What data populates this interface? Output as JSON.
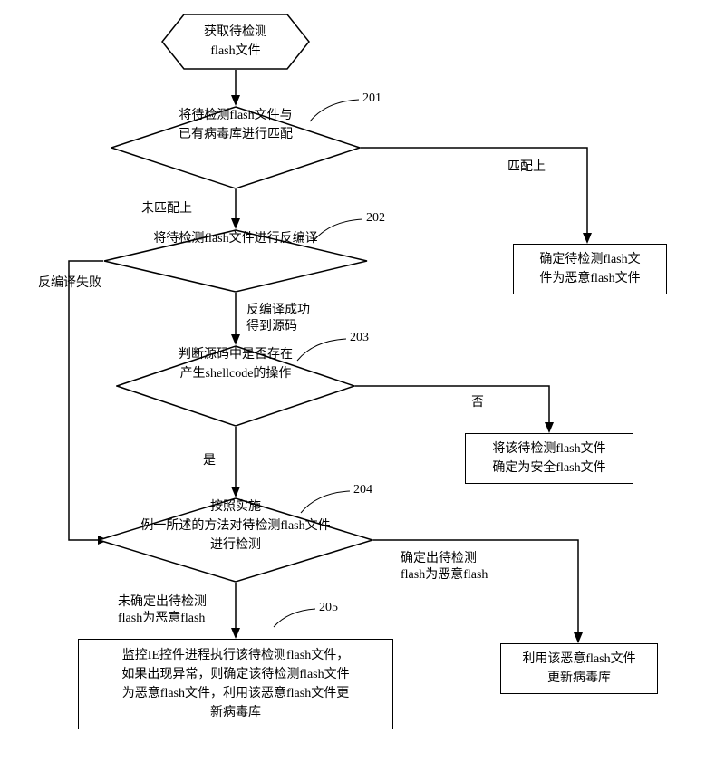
{
  "title": "恶意flash文件检测流程图",
  "start": {
    "text": "获取待检测\nflash文件"
  },
  "steps": {
    "s201": {
      "num": "201",
      "text": "将待检测flash文件与\n已有病毒库进行匹配"
    },
    "s202": {
      "num": "202",
      "text": "将待检测flash文件进行反编译"
    },
    "s203": {
      "num": "203",
      "text": "判断源码中是否存在\n产生shellcode的操作"
    },
    "s204": {
      "num": "204",
      "text": "按照实施\n例一所述的方法对待检测flash文件\n进行检测"
    },
    "s205": {
      "num": "205",
      "text": "监控IE控件进程执行该待检测flash文件，\n如果出现异常，则确定该待检测flash文件\n为恶意flash文件，利用该恶意flash文件更\n新病毒库"
    }
  },
  "boxes": {
    "malicious": "确定待检测flash文\n件为恶意flash文件",
    "safe": "将该待检测flash文件\n确定为安全flash文件",
    "update": "利用该恶意flash文件\n更新病毒库"
  },
  "edges": {
    "matched": "匹配上",
    "unmatched": "未匹配上",
    "decomp_fail": "反编译失败",
    "decomp_ok": "反编译成功\n得到源码",
    "yes": "是",
    "no": "否",
    "detected_mal": "确定出待检测\nflash为恶意flash",
    "not_detected": "未确定出待检测\nflash为恶意flash"
  }
}
